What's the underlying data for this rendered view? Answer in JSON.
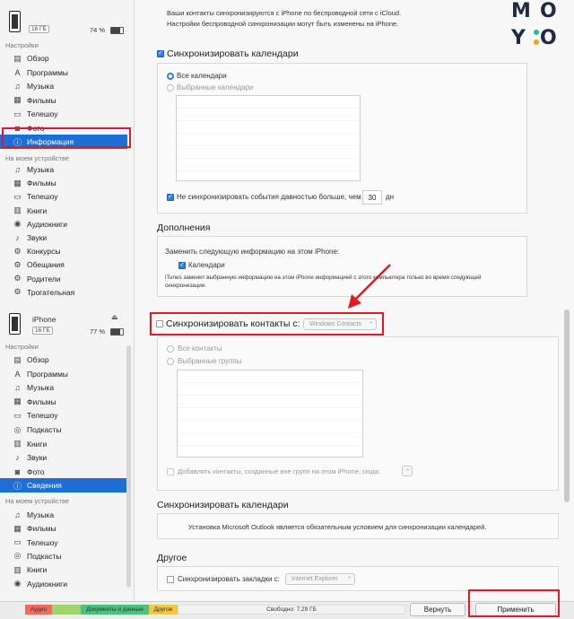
{
  "sidebar_top": {
    "capacity_badge": "16 ГБ",
    "battery_text": "74 %",
    "battery_level": 0.74,
    "section_settings": "Настройки",
    "settings_items": [
      {
        "label": "Обзор",
        "icon": "overview-icon"
      },
      {
        "label": "Программы",
        "icon": "apps-icon"
      },
      {
        "label": "Музыка",
        "icon": "music-icon"
      },
      {
        "label": "Фильмы",
        "icon": "film-icon"
      },
      {
        "label": "Телешоу",
        "icon": "tv-icon"
      },
      {
        "label": "Фото",
        "icon": "photo-icon"
      },
      {
        "label": "Информация",
        "icon": "info-icon",
        "selected": true
      }
    ],
    "section_device": "На моем устройстве",
    "device_items": [
      {
        "label": "Музыка",
        "icon": "music-icon"
      },
      {
        "label": "Фильмы",
        "icon": "film-icon"
      },
      {
        "label": "Телешоу",
        "icon": "tv-icon"
      },
      {
        "label": "Книги",
        "icon": "book-icon"
      },
      {
        "label": "Аудиокниги",
        "icon": "audiobook-icon"
      },
      {
        "label": "Звуки",
        "icon": "bell-icon"
      },
      {
        "label": "Конкурсы",
        "icon": "gear-icon"
      },
      {
        "label": "Обещания",
        "icon": "gear-icon"
      },
      {
        "label": "Родители",
        "icon": "gear-icon"
      },
      {
        "label": "Трогательная",
        "icon": "gear-icon"
      }
    ]
  },
  "sidebar_bottom": {
    "device_name": "iPhone",
    "capacity_badge": "16 ГБ",
    "battery_text": "77 %",
    "battery_level": 0.77,
    "section_settings": "Настройки",
    "settings_items": [
      {
        "label": "Обзор",
        "icon": "overview-icon"
      },
      {
        "label": "Программы",
        "icon": "apps-icon"
      },
      {
        "label": "Музыка",
        "icon": "music-icon"
      },
      {
        "label": "Фильмы",
        "icon": "film-icon"
      },
      {
        "label": "Телешоу",
        "icon": "tv-icon"
      },
      {
        "label": "Подкасты",
        "icon": "podcast-icon"
      },
      {
        "label": "Книги",
        "icon": "book-icon"
      },
      {
        "label": "Звуки",
        "icon": "bell-icon"
      },
      {
        "label": "Фото",
        "icon": "photo-icon"
      },
      {
        "label": "Сведения",
        "icon": "info-icon",
        "selected": true
      }
    ],
    "section_device": "На моем устройстве",
    "device_items": [
      {
        "label": "Музыка",
        "icon": "music-icon"
      },
      {
        "label": "Фильмы",
        "icon": "film-icon"
      },
      {
        "label": "Телешоу",
        "icon": "tv-icon"
      },
      {
        "label": "Подкасты",
        "icon": "podcast-icon"
      },
      {
        "label": "Книги",
        "icon": "book-icon"
      },
      {
        "label": "Аудиокниги",
        "icon": "audiobook-icon"
      }
    ]
  },
  "main_top": {
    "icloud_line1": "Ваши контакты синхронизируются с iPhone по беспроводной сети с iCloud.",
    "icloud_line2": "Настройки беспроводной синхронизации могут быть изменены на iPhone.",
    "sync_calendars_label": "Синхронизировать календари",
    "all_calendars": "Все календари",
    "selected_calendars": "Выбранные календари",
    "no_sync_older_label": "Не синхронизировать события давностью больше, чем",
    "days_value": "30",
    "days_unit": "дн",
    "addons_heading": "Дополнения",
    "replace_info_label": "Заменить следующую информацию на этом iPhone:",
    "calendars_checkbox": "Календари",
    "itunes_note_line1": "iTunes заменит выбранную информацию на этом iPhone информацией с этого компьютера только во время следующей",
    "itunes_note_line2": "синхронизации."
  },
  "main_bottom": {
    "sync_contacts_label": "Синхронизировать контакты с:",
    "contacts_source": "Windows Contacts",
    "all_contacts": "Все контакты",
    "selected_groups": "Выбранные группы",
    "add_contacts_label": "Добавлять контакты, созданные вне групп на этом iPhone, сюда:",
    "sync_calendars_heading": "Синхронизировать календари",
    "outlook_notice": "Установка Microsoft Outlook является обязательным условием для синхронизации календарей.",
    "other_heading": "Другое",
    "sync_bookmarks_label": "Синхронизировать закладки с:",
    "bookmarks_source": "Internet Explorer"
  },
  "capacity_bar": {
    "audio": "Аудио",
    "docs": "Документы и данные",
    "other": "Другое",
    "free": "Свободно: 7,29 ГБ",
    "colors": {
      "audio": "#ef6b5c",
      "photo": "#9fd36b",
      "docs": "#4bc17a",
      "other": "#f2c840",
      "free": "#f2f2f2"
    }
  },
  "buttons": {
    "revert": "Вернуть",
    "apply": "Применить"
  },
  "logo": {
    "letters": [
      "M",
      "O",
      "Y",
      "O"
    ],
    "colors": {
      "text": "#1f2a44",
      "dot_teal": "#25b8b0",
      "dot_orange": "#f2a31b"
    }
  },
  "annotation_color": "#e01b24"
}
